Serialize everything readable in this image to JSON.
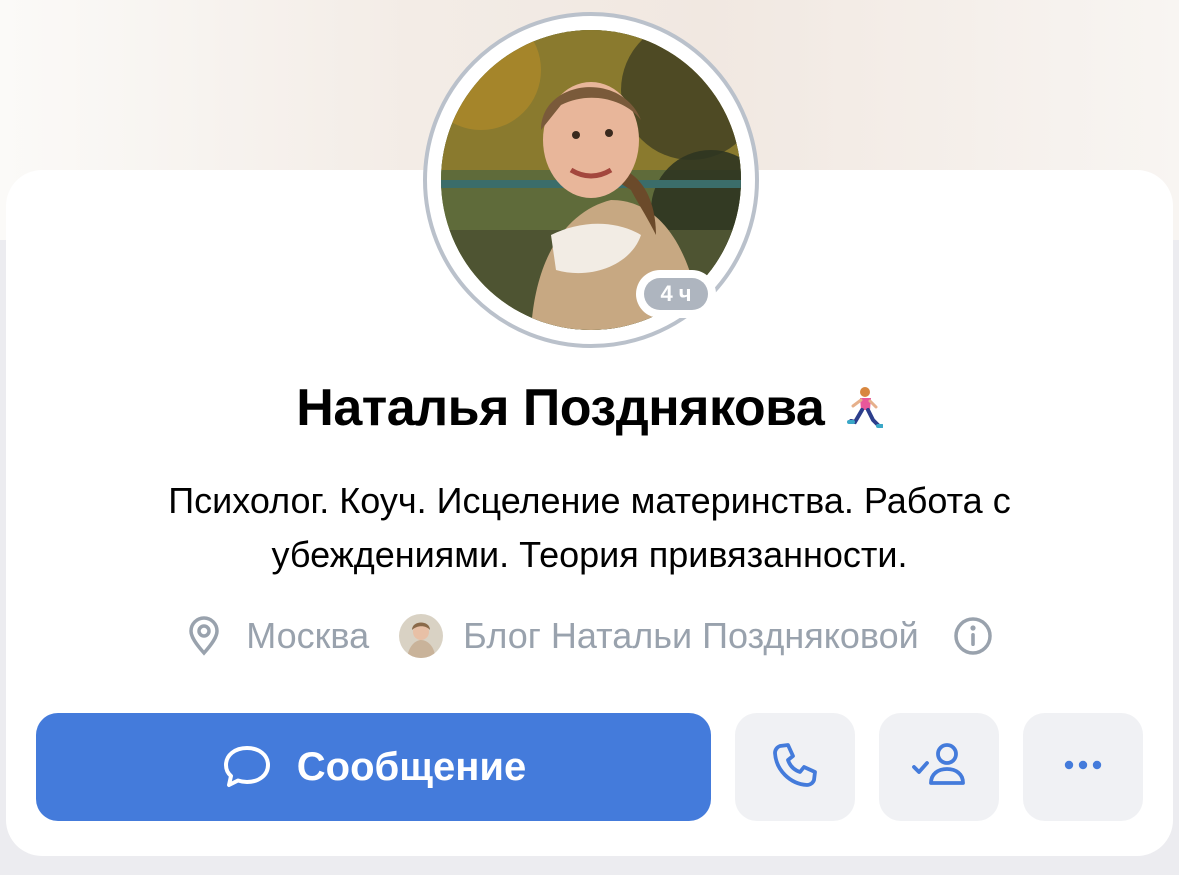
{
  "profile": {
    "name": "Наталья Позднякова",
    "status_emoji": "runner-emoji",
    "story_badge": "4 ч",
    "bio": "Психолог. Коуч. Исцеление материнства. Работа с убеждениями. Теория привязанности.",
    "city": "Москва",
    "blog": "Блог Натальи Поздняковой"
  },
  "actions": {
    "message_label": "Сообщение",
    "call_icon": "phone-icon",
    "friend_icon": "friend-added-icon",
    "more_icon": "more-icon"
  },
  "colors": {
    "accent": "#447bdb",
    "secondary_text": "#99a2ad",
    "button_bg": "#f0f1f4"
  }
}
